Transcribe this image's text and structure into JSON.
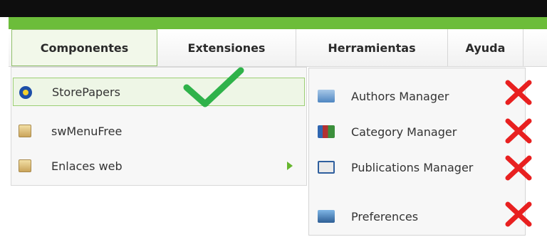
{
  "menubar": {
    "tabs": [
      {
        "label": "Componentes"
      },
      {
        "label": "Extensiones"
      },
      {
        "label": "Herramientas"
      },
      {
        "label": "Ayuda"
      }
    ]
  },
  "dropdown": {
    "items": [
      {
        "label": "StorePapers",
        "icon": "storepapers-icon"
      },
      {
        "label": "swMenuFree",
        "icon": "folder-icon"
      },
      {
        "label": "Enlaces web",
        "icon": "folder-icon"
      }
    ]
  },
  "submenu": {
    "items": [
      {
        "label": "Authors Manager",
        "icon": "authors-icon"
      },
      {
        "label": "Category Manager",
        "icon": "category-icon"
      },
      {
        "label": "Publications Manager",
        "icon": "publications-icon"
      },
      {
        "label": "Preferences",
        "icon": "preferences-icon"
      }
    ]
  },
  "colors": {
    "accent_green": "#6cbd3a",
    "checkmark_green": "#2fb24a",
    "x_mark_red": "#e82020"
  }
}
